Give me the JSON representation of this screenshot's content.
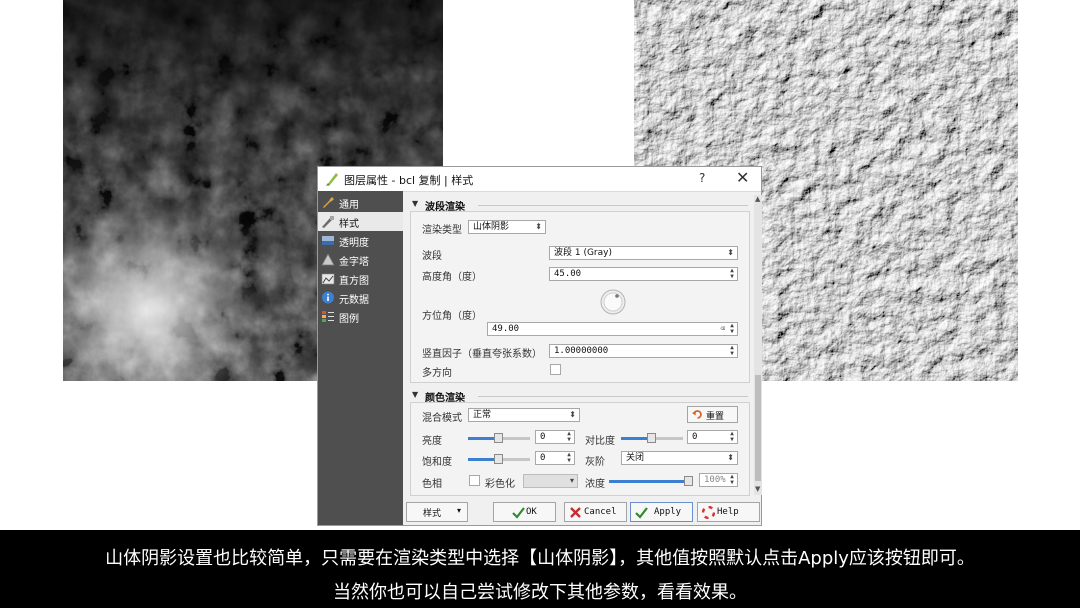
{
  "dialog": {
    "title": "图层属性 - bcl 复制 | 样式",
    "help_label": "?",
    "close_label": "✕"
  },
  "sidebar": {
    "items": [
      {
        "label": "通用",
        "icon": "wrench-icon"
      },
      {
        "label": "样式",
        "icon": "brush-icon"
      },
      {
        "label": "透明度",
        "icon": "transparency-icon"
      },
      {
        "label": "金字塔",
        "icon": "pyramid-icon"
      },
      {
        "label": "直方图",
        "icon": "histogram-icon"
      },
      {
        "label": "元数据",
        "icon": "info-icon"
      },
      {
        "label": "图例",
        "icon": "legend-icon"
      }
    ]
  },
  "band_render": {
    "section_title": "波段渲染",
    "render_type_label": "渲染类型",
    "render_type_value": "山体阴影",
    "band_label": "波段",
    "band_value": "波段 1 (Gray)",
    "altitude_label": "高度角（度）",
    "altitude_value": "45.00",
    "azimuth_label": "方位角（度）",
    "azimuth_value": "49.00",
    "z_factor_label": "竖直因子（垂直夸张系数）",
    "z_factor_value": "1.00000000",
    "multidirectional_label": "多方向"
  },
  "color_render": {
    "section_title": "颜色渲染",
    "blend_label": "混合模式",
    "blend_value": "正常",
    "reset_label": "重置",
    "brightness_label": "亮度",
    "brightness_value": "0",
    "contrast_label": "对比度",
    "contrast_value": "0",
    "saturation_label": "饱和度",
    "saturation_value": "0",
    "grayscale_label": "灰阶",
    "grayscale_value": "关闭",
    "hue_label": "色相",
    "colorize_label": "彩色化",
    "strength_label": "浓度",
    "strength_value": "100%"
  },
  "buttons": {
    "style_label": "样式",
    "ok_label": "OK",
    "cancel_label": "Cancel",
    "apply_label": "Apply",
    "help_label": "Help"
  },
  "caption": {
    "line1": "山体阴影设置也比较简单，只需要在渲染类型中选择【山体阴影】，其他值按照默认点击Apply应该按钮即可。",
    "line2": "当然你也可以自己尝试修改下其他参数，看看效果。"
  },
  "colors": {
    "sidebar_bg": "#4f4f4f",
    "slider_fill": "#3b80d0",
    "caption_bg": "#000000"
  }
}
